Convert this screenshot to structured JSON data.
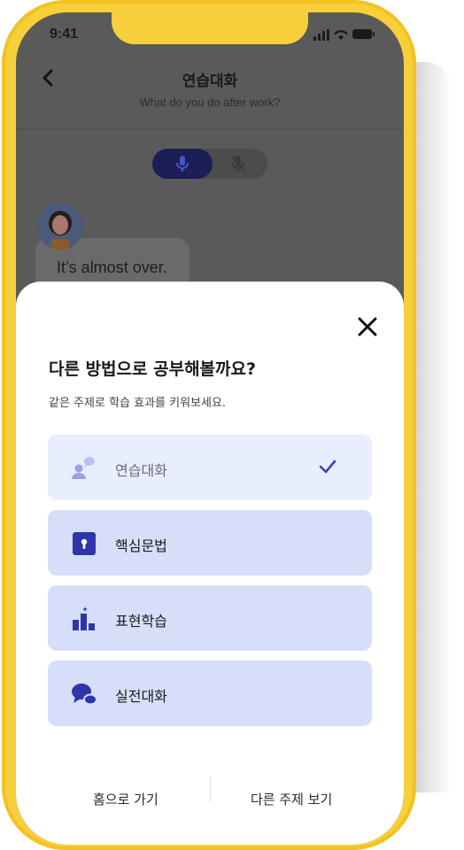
{
  "status": {
    "time": "9:41"
  },
  "header": {
    "title": "연습대화",
    "subtitle": "What do you do after work?"
  },
  "chat": {
    "message": "It’s almost over."
  },
  "sheet": {
    "title": "다른 방법으로 공부해볼까요?",
    "subtitle": "같은 주제로 학습 효과를 키워보세요.",
    "options": [
      {
        "label": "연습대화",
        "icon": "chat-person-icon",
        "selected": true
      },
      {
        "label": "핵심문법",
        "icon": "lock-book-icon",
        "selected": false
      },
      {
        "label": "표현학습",
        "icon": "podium-icon",
        "selected": false
      },
      {
        "label": "실전대화",
        "icon": "speech-bubbles-icon",
        "selected": false
      }
    ],
    "footer": {
      "home_label": "홈으로 가기",
      "other_topic_label": "다른 주제 보기"
    }
  },
  "colors": {
    "frame": "#f7cf3a",
    "accent": "#3d44b6",
    "option_bg": "#d6def9",
    "option_selected_bg": "#e8eefd",
    "mic_active": "#1b1f55"
  }
}
